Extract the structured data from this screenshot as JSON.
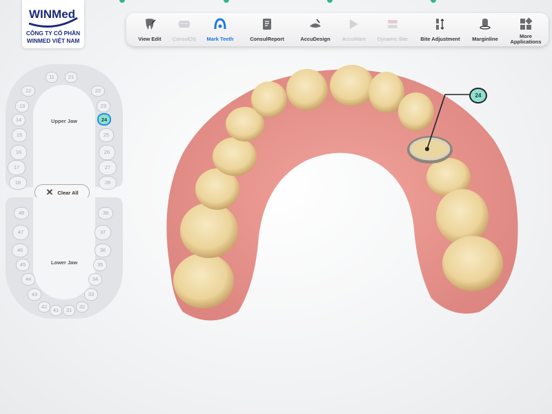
{
  "logo": {
    "brand": "WINMed",
    "line1": "CÔNG TY CỔ PHẦN",
    "line2": "WINMED VIỆT NAM"
  },
  "toolbar": {
    "items": [
      {
        "label": "View Edit",
        "icon": "view-edit-icon",
        "state": "normal"
      },
      {
        "label": "ConsulOS",
        "icon": "consulos-icon",
        "state": "disabled"
      },
      {
        "label": "Mark Teeth",
        "icon": "mark-teeth-icon",
        "state": "active"
      },
      {
        "label": "ConsulReport",
        "icon": "report-icon",
        "state": "normal"
      },
      {
        "label": "AccuDesign",
        "icon": "accudesign-icon",
        "state": "normal"
      },
      {
        "label": "AccuWare",
        "icon": "accuware-icon",
        "state": "disabled"
      },
      {
        "label": "Dynamic Bite",
        "icon": "dynamic-bite-icon",
        "state": "disabled"
      },
      {
        "label": "Bite Adjustment",
        "icon": "bite-adjustment-icon",
        "state": "normal"
      },
      {
        "label": "Marginline",
        "icon": "marginline-icon",
        "state": "normal"
      },
      {
        "label": "More Applications",
        "icon": "grid-icon",
        "state": "normal"
      }
    ]
  },
  "upper_jaw": {
    "label": "Upper Jaw",
    "teeth": [
      "11",
      "21",
      "12",
      "22",
      "13",
      "23",
      "14",
      "24",
      "15",
      "25",
      "16",
      "26",
      "17",
      "27",
      "18",
      "28"
    ]
  },
  "lower_jaw": {
    "label": "Lower Jaw",
    "teeth": [
      "48",
      "38",
      "47",
      "37",
      "46",
      "36",
      "45",
      "35",
      "44",
      "34",
      "43",
      "33",
      "42",
      "41",
      "31",
      "32"
    ]
  },
  "selected_tooth": "24",
  "clear_all": "Clear All",
  "callout_label": "24",
  "colors": {
    "accent": "#1a78e0",
    "selected_fill": "#8fe0d2",
    "gum": "#e9908a",
    "tooth": "#f3e2b8"
  }
}
